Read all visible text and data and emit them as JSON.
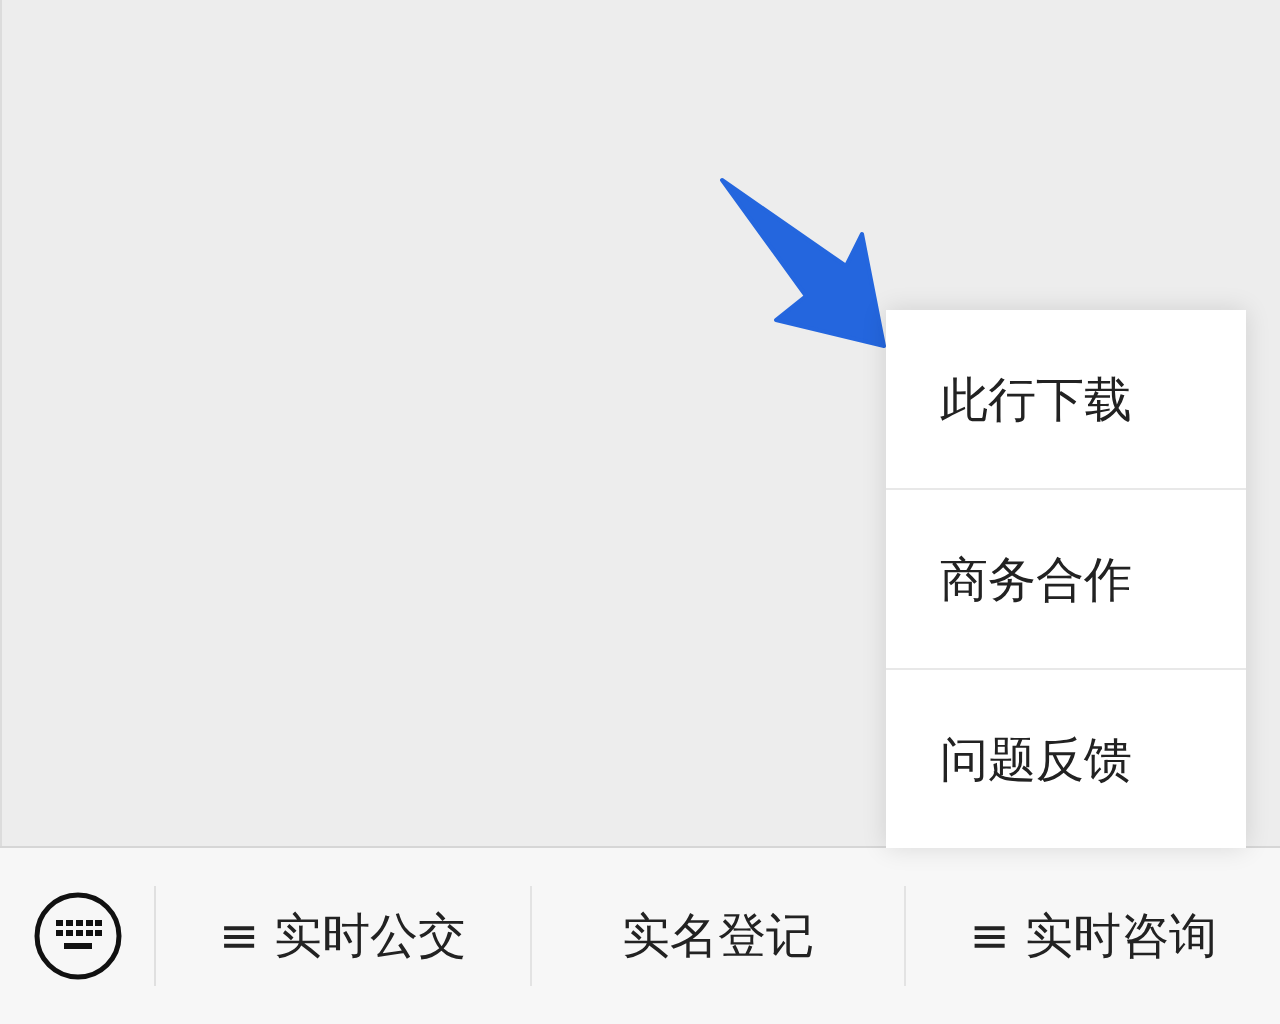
{
  "popup_menu": {
    "items": [
      {
        "label": "此行下载"
      },
      {
        "label": "商务合作"
      },
      {
        "label": "问题反馈"
      }
    ]
  },
  "bottom_bar": {
    "items": [
      {
        "label": "实时公交",
        "glyph": "≡"
      },
      {
        "label": "实名登记"
      },
      {
        "label": "实时咨询",
        "glyph": "≡"
      }
    ]
  }
}
